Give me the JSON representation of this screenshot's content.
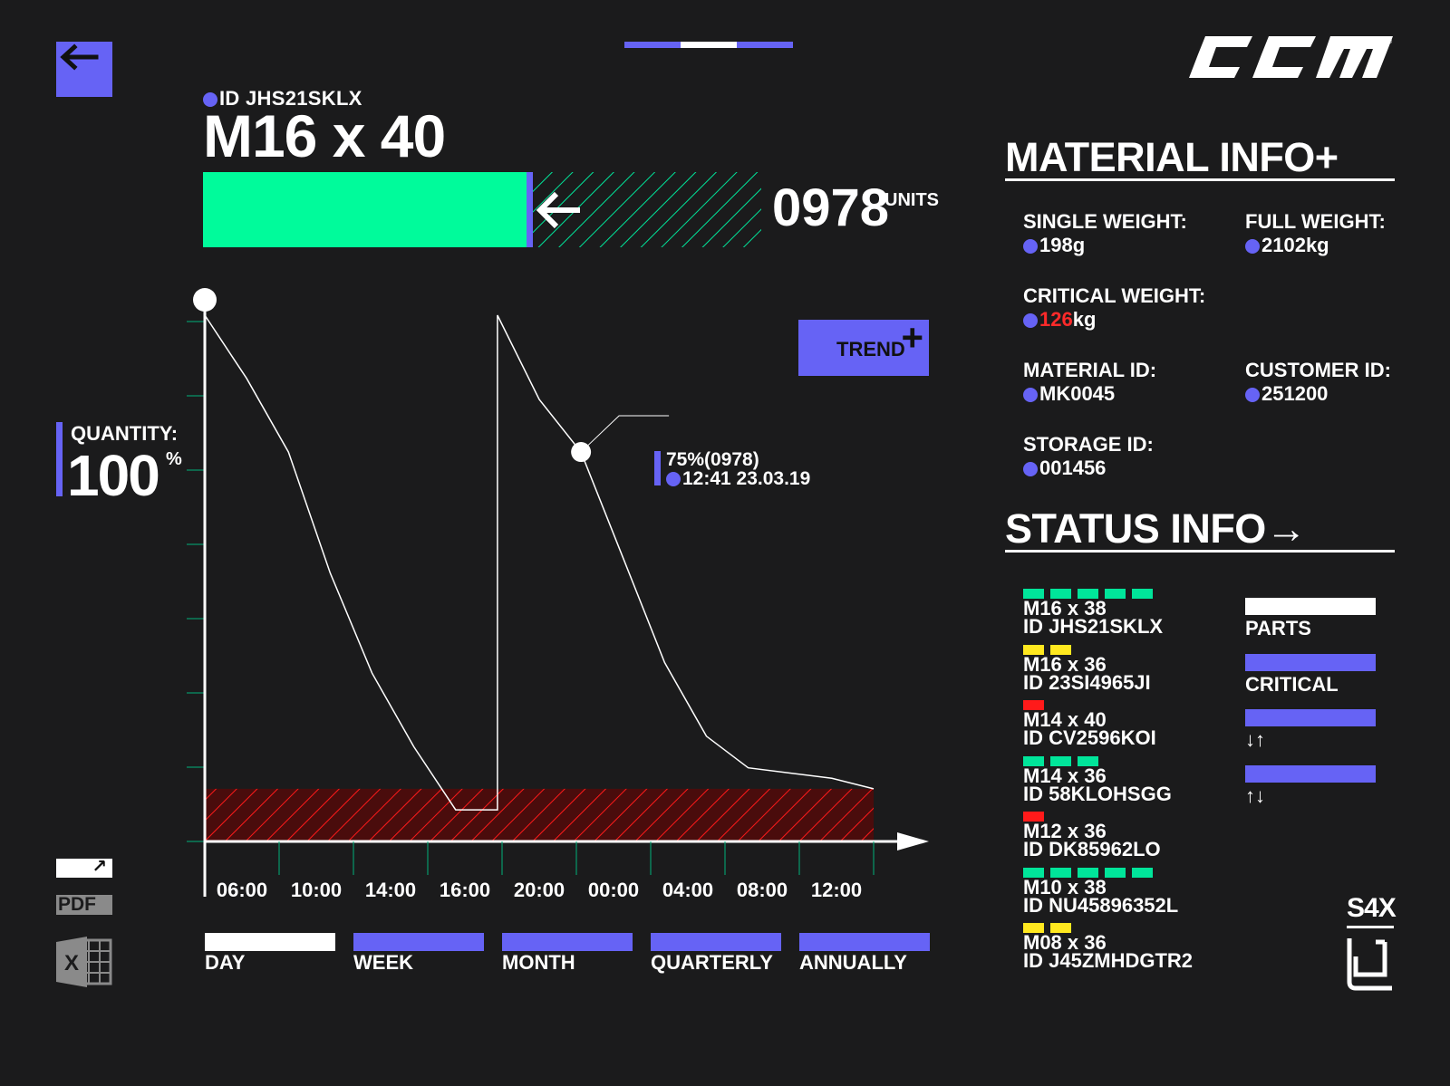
{
  "header": {
    "material_id_line": "ID JHS21SKLX",
    "title": "M16 x 40",
    "units_value": "0978",
    "units_label": "UNITS",
    "stock_fraction": 0.58,
    "page_count": 3,
    "active_page": 2
  },
  "logo": {
    "text": "CCM"
  },
  "quantity": {
    "label": "QUANTITY:",
    "value": "100",
    "unit": "%"
  },
  "trend_button": {
    "label": "TREND",
    "icon": "plus-icon"
  },
  "tooltip": {
    "value": "75%(0978)",
    "time": "12:41 23.03.19"
  },
  "chart_data": {
    "type": "line",
    "x": [
      "04:00",
      "06:00",
      "08:00",
      "10:00",
      "12:00",
      "14:00",
      "16:00",
      "18:00",
      "18:00",
      "20:00",
      "22:00",
      "00:00",
      "02:00",
      "04:00",
      "06:00",
      "08:00",
      "10:00",
      "12:00"
    ],
    "x_tick_labels": [
      "06:00",
      "10:00",
      "14:00",
      "16:00",
      "20:00",
      "00:00",
      "04:00",
      "08:00",
      "12:00"
    ],
    "values": [
      100,
      88,
      74,
      51,
      32,
      18,
      6,
      6,
      100,
      84,
      74,
      54,
      34,
      20,
      14,
      13,
      12,
      10
    ],
    "ylim": [
      0,
      100
    ],
    "critical_threshold": 10,
    "highlight_point_index": 10,
    "grid": false
  },
  "periods": [
    {
      "label": "DAY",
      "active": true
    },
    {
      "label": "WEEK",
      "active": false
    },
    {
      "label": "MONTH",
      "active": false
    },
    {
      "label": "QUARTERLY",
      "active": false
    },
    {
      "label": "ANNUALLY",
      "active": false
    }
  ],
  "exports": {
    "pdf_label": "PDF",
    "excel_label": "X",
    "link_icon": "external-link-icon"
  },
  "material_info": {
    "title": "MATERIAL INFO+",
    "single_weight_label": "SINGLE WEIGHT:",
    "single_weight_value": "198g",
    "full_weight_label": "FULL WEIGHT:",
    "full_weight_value": "2102kg",
    "critical_weight_label": "CRITICAL WEIGHT:",
    "critical_weight_number": "126",
    "critical_weight_unit": "kg",
    "material_id_label": "MATERIAL ID:",
    "material_id_value": "MK0045",
    "customer_id_label": "CUSTOMER ID:",
    "customer_id_value": "251200",
    "storage_id_label": "STORAGE ID:",
    "storage_id_value": "001456"
  },
  "status_info": {
    "title": "STATUS INFO→",
    "items": [
      {
        "name": "M16 x 38",
        "id": "ID JHS21SKLX",
        "level": 5,
        "color": "#00e59a"
      },
      {
        "name": "M16 x 36",
        "id": "ID 23SI4965JI",
        "level": 2,
        "color": "#ffe81f"
      },
      {
        "name": "M14 x 40",
        "id": "ID CV2596KOI",
        "level": 1,
        "color": "#ff1a1a"
      },
      {
        "name": "M14 x 36",
        "id": "ID 58KLOHSGG",
        "level": 3,
        "color": "#00e59a"
      },
      {
        "name": "M12 x 36",
        "id": "ID DK85962LO",
        "level": 1,
        "color": "#ff1a1a"
      },
      {
        "name": "M10 x 38",
        "id": "ID NU45896352L",
        "level": 5,
        "color": "#00e59a"
      },
      {
        "name": "M08 x 36",
        "id": "ID J45ZMHDGTR2",
        "level": 2,
        "color": "#ffe81f"
      }
    ],
    "legend": [
      {
        "label": "PARTS",
        "color": "#ffffff"
      },
      {
        "label": "CRITICAL",
        "color": "#6663f5"
      },
      {
        "label": "↓↑",
        "color": "#6663f5"
      },
      {
        "label": "↑↓",
        "color": "#6663f5"
      }
    ]
  },
  "brand": {
    "code": "S4X"
  },
  "colors": {
    "accent": "#6663f5",
    "success": "#00fb9b",
    "critical": "#ff1a1a",
    "warning": "#ffe81f",
    "background": "#1b1b1c"
  }
}
